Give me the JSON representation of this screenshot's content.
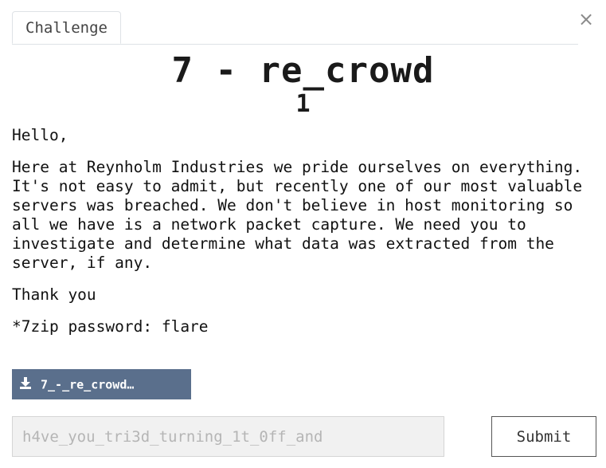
{
  "modal": {
    "close_symbol": "×",
    "tabs": [
      {
        "label": "Challenge"
      }
    ],
    "challenge": {
      "title": "7 - re_crowd",
      "points": "1",
      "description": [
        "Hello,",
        "Here at Reynholm Industries we pride ourselves on everything. It's not easy to admit, but recently one of our most valuable servers was breached. We don't believe in host monitoring so all we have is a network packet capture. We need you to investigate and determine what data was extracted from the server, if any.",
        "Thank you",
        "*7zip password: flare"
      ],
      "download_label": "7_-_re_crowd…"
    },
    "flag_input": {
      "value": "h4ve_you_tri3d_turning_1t_0ff_and"
    },
    "submit_label": "Submit"
  },
  "colors": {
    "download_button_bg": "#5a6f8c",
    "input_bg": "#f1f1f1",
    "text": "#1a1a1a"
  },
  "icons": {
    "close": "close-icon",
    "download": "download-icon"
  }
}
